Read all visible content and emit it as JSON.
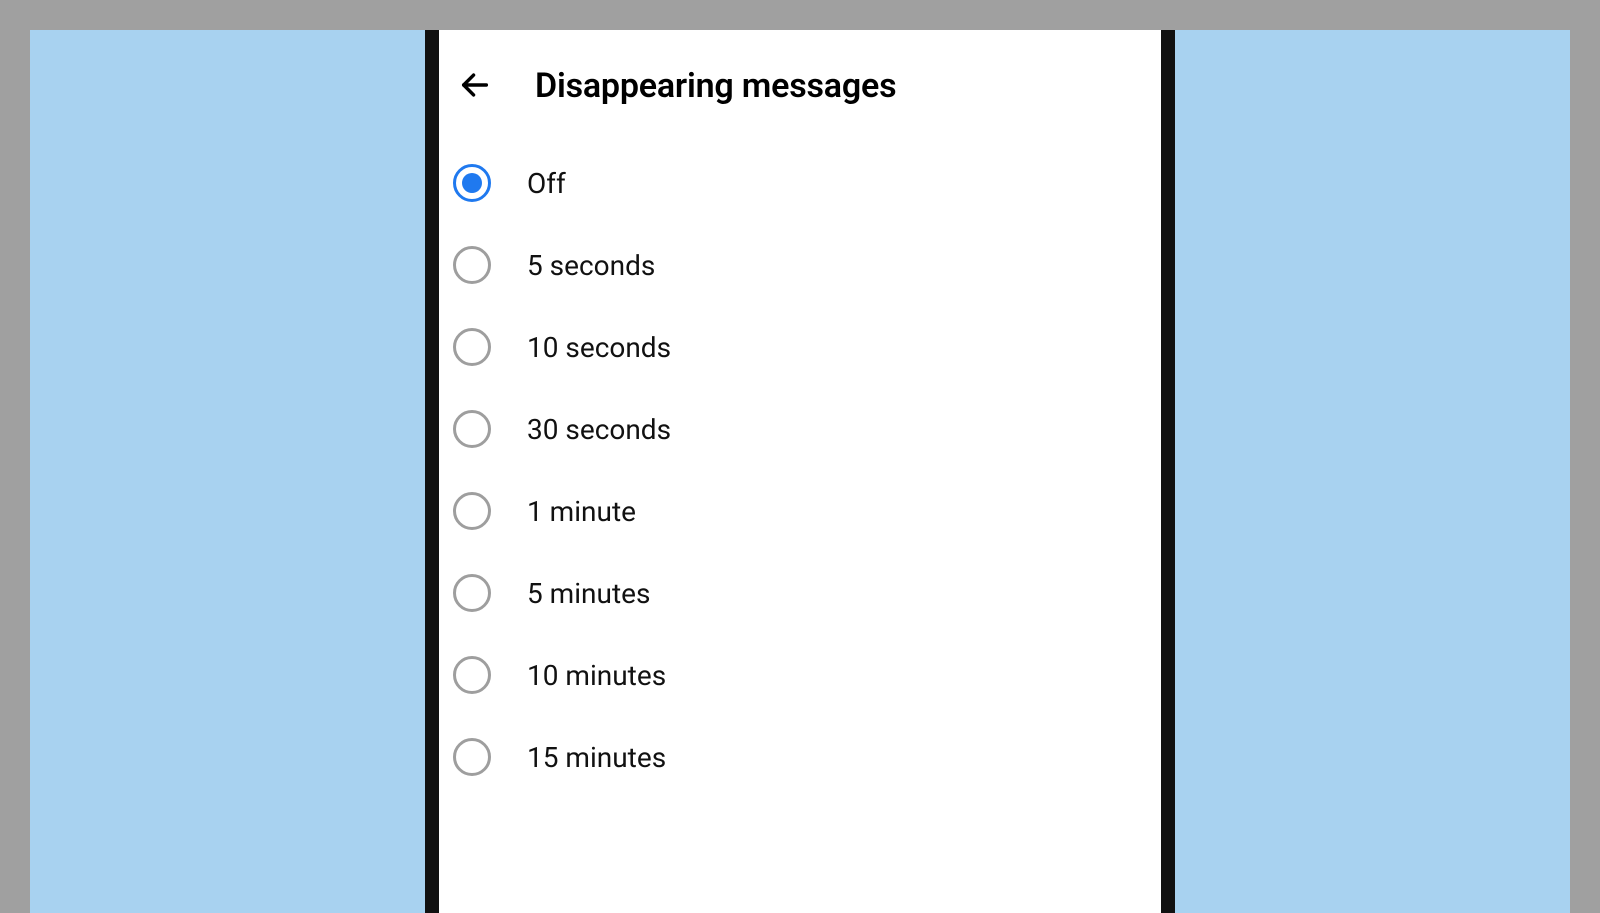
{
  "header": {
    "title": "Disappearing messages"
  },
  "options": [
    {
      "label": "Off",
      "selected": true
    },
    {
      "label": "5 seconds",
      "selected": false
    },
    {
      "label": "10 seconds",
      "selected": false
    },
    {
      "label": "30 seconds",
      "selected": false
    },
    {
      "label": "1 minute",
      "selected": false
    },
    {
      "label": "5 minutes",
      "selected": false
    },
    {
      "label": "10 minutes",
      "selected": false
    },
    {
      "label": "15 minutes",
      "selected": false
    }
  ],
  "colors": {
    "accent": "#1f79ef",
    "page_bg": "#a0a0a0",
    "panel_bg": "#a8d2f0"
  }
}
